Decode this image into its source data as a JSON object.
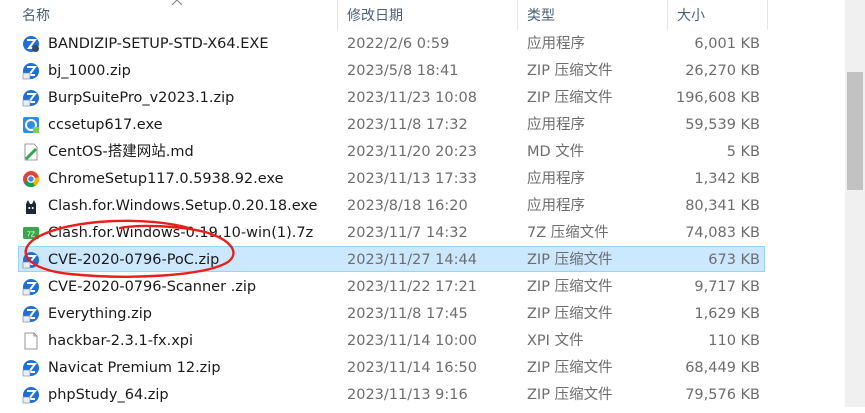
{
  "header": {
    "name": "名称",
    "modified": "修改日期",
    "type": "类型",
    "size": "大小"
  },
  "files": [
    {
      "name": "BANDIZIP-SETUP-STD-X64.EXE",
      "date": "2022/2/6 0:59",
      "type": "应用程序",
      "size": "6,001 KB",
      "icon": "bandizip-installer-icon"
    },
    {
      "name": "bj_1000.zip",
      "date": "2023/5/8 18:41",
      "type": "ZIP 压缩文件",
      "size": "26,270 KB",
      "icon": "zip-archive-icon"
    },
    {
      "name": "BurpSuitePro_v2023.1.zip",
      "date": "2023/11/23 10:08",
      "type": "ZIP 压缩文件",
      "size": "196,608 KB",
      "icon": "zip-archive-icon"
    },
    {
      "name": "ccsetup617.exe",
      "date": "2023/11/8 17:32",
      "type": "应用程序",
      "size": "59,539 KB",
      "icon": "ccleaner-installer-icon"
    },
    {
      "name": "CentOS-搭建网站.md",
      "date": "2023/11/20 20:23",
      "type": "MD 文件",
      "size": "5 KB",
      "icon": "markdown-file-icon"
    },
    {
      "name": "ChromeSetup117.0.5938.92.exe",
      "date": "2023/11/13 17:33",
      "type": "应用程序",
      "size": "1,342 KB",
      "icon": "chrome-installer-icon"
    },
    {
      "name": "Clash.for.Windows.Setup.0.20.18.exe",
      "date": "2023/8/18 16:20",
      "type": "应用程序",
      "size": "80,341 KB",
      "icon": "clash-cat-icon"
    },
    {
      "name": "Clash.for.Windows-0.19.10-win(1).7z",
      "date": "2023/11/7 14:32",
      "type": "7Z 压缩文件",
      "size": "74,083 KB",
      "icon": "7z-archive-icon"
    },
    {
      "name": "CVE-2020-0796-PoC.zip",
      "date": "2023/11/27 14:44",
      "type": "ZIP 压缩文件",
      "size": "673 KB",
      "icon": "zip-archive-icon"
    },
    {
      "name": "CVE-2020-0796-Scanner .zip",
      "date": "2023/11/22 17:21",
      "type": "ZIP 压缩文件",
      "size": "9,717 KB",
      "icon": "zip-archive-icon"
    },
    {
      "name": "Everything.zip",
      "date": "2023/11/8 17:45",
      "type": "ZIP 压缩文件",
      "size": "1,629 KB",
      "icon": "zip-archive-icon"
    },
    {
      "name": "hackbar-2.3.1-fx.xpi",
      "date": "2023/11/14 10:00",
      "type": "XPI 文件",
      "size": "110 KB",
      "icon": "blank-file-icon"
    },
    {
      "name": "Navicat Premium 12.zip",
      "date": "2023/11/14 16:50",
      "type": "ZIP 压缩文件",
      "size": "68,449 KB",
      "icon": "zip-archive-icon"
    },
    {
      "name": "phpStudy_64.zip",
      "date": "2023/11/13 9:16",
      "type": "ZIP 压缩文件",
      "size": "79,576 KB",
      "icon": "zip-archive-icon"
    }
  ],
  "selected_index": 8,
  "colors": {
    "selection_bg": "#cce8ff",
    "selection_border": "#99d1ff",
    "annotation_red": "#e8201c",
    "zip_blue": "#1f6fd6"
  }
}
